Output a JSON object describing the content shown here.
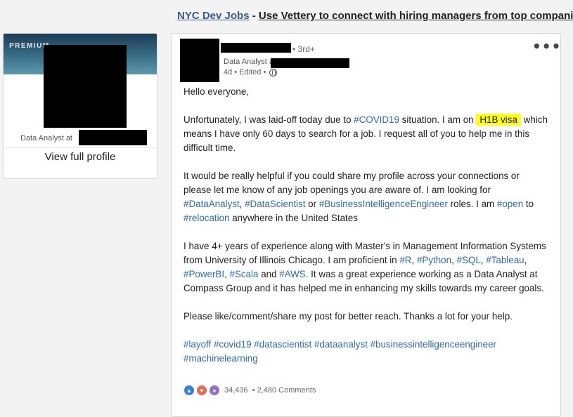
{
  "ad": {
    "link": "NYC Dev Jobs",
    "separator": " - ",
    "text": "Use Vettery to connect with hiring managers from top companies"
  },
  "profile": {
    "banner_label": "PREMIUM",
    "headline": "Data Analyst at",
    "view_profile": "View full profile"
  },
  "post": {
    "degree": "• 3rd+",
    "headline": "Data Analyst at",
    "meta": "4d • Edited •",
    "more": "•••",
    "greeting": "Hello everyone,",
    "p1_a": "Unfortunately, I was laid-off today due to ",
    "p1_tag": "#COVID19",
    "p1_b": " situation. I am on ",
    "p1_highlight": "H1B visa",
    "p1_c": " which means I have only 60 days to search for a job. I request all of you to help me in this difficult time.",
    "p2_a": "It would be really helpful if you could share my profile across your connections or please let me know of any job openings you are aware of. I am looking for ",
    "p2_tag1": "#DataAnalyst",
    "p2_sep1": ", ",
    "p2_tag2": "#DataScientist",
    "p2_or": " or ",
    "p2_tag3": "#BusinessIntelligenceEngineer",
    "p2_b": " roles. I am ",
    "p2_tag4": "#open",
    "p2_to": " to ",
    "p2_tag5": "#relocation",
    "p2_c": " anywhere in the United States",
    "p3_a": "I have 4+ years of experience along with Master's in Management Information Systems from University of Illinois Chicago. I am proficient in ",
    "p3_tag1": "#R",
    "p3_tag2": "#Python",
    "p3_tag3": "#SQL",
    "p3_tag4": "#Tableau",
    "p3_tag5": "#PowerBI",
    "p3_tag6": "#Scala",
    "p3_and": " and ",
    "p3_tag7": "#AWS",
    "p3_b": ". It was a great experience working as a Data Analyst at Compass Group and it has helped me in enhancing my skills towards my career goals.",
    "p4": "Please like/comment/share my post for better reach. Thanks a lot for your help.",
    "hashtags": [
      "#layoff",
      "#covid19",
      "#datascientist",
      "#dataanalyst",
      "#businessintelligenceengineer",
      "#machinelearning"
    ],
    "reaction_count": "34,436",
    "comments": "• 2,480 Comments"
  },
  "icons": [
    "globe-icon",
    "more-icon",
    "like-reaction-icon",
    "love-reaction-icon",
    "curious-reaction-icon"
  ],
  "colors": {
    "hashtag": "#2e6aa8",
    "highlight": "#ffff1a",
    "ad_link": "#3a5a8c"
  }
}
